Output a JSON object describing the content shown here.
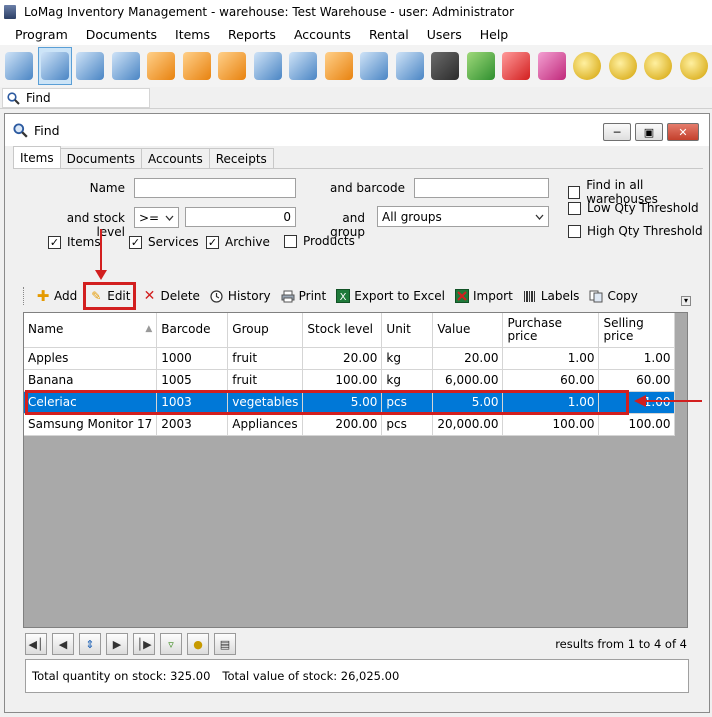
{
  "app": {
    "title": "LoMag Inventory Management - warehouse: Test Warehouse - user: Administrator"
  },
  "menu": [
    "Program",
    "Documents",
    "Items",
    "Reports",
    "Accounts",
    "Rental",
    "Users",
    "Help"
  ],
  "find_tab": {
    "label": "Find"
  },
  "window": {
    "title": "Find"
  },
  "subtabs": [
    "Items",
    "Documents",
    "Accounts",
    "Receipts"
  ],
  "form": {
    "name_label": "Name",
    "name_value": "",
    "barcode_label": "and barcode",
    "barcode_value": "",
    "stock_level_label": "and stock level",
    "stock_operator": ">=",
    "stock_value": "0",
    "group_label": "and group",
    "group_value": "All groups",
    "checks": {
      "items": {
        "label": "Items",
        "checked": true
      },
      "services": {
        "label": "Services",
        "checked": true
      },
      "archive": {
        "label": "Archive",
        "checked": true
      },
      "products": {
        "label": "Products",
        "checked": false
      },
      "all_warehouses": {
        "label": "Find in all warehouses",
        "checked": false
      },
      "low_qty": {
        "label": "Low Qty Threshold",
        "checked": false
      },
      "high_qty": {
        "label": "High Qty Threshold",
        "checked": false
      }
    }
  },
  "actions": {
    "add": "Add",
    "edit": "Edit",
    "delete": "Delete",
    "history": "History",
    "print": "Print",
    "export": "Export to Excel",
    "import": "Import",
    "labels": "Labels",
    "copy": "Copy"
  },
  "table": {
    "columns": [
      "Name",
      "Barcode",
      "Group",
      "Stock level",
      "Unit",
      "Value",
      "Purchase price",
      "Selling price"
    ],
    "rows": [
      [
        "Apples",
        "1000",
        "fruit",
        "20.00",
        "kg",
        "20.00",
        "1.00",
        "1.00"
      ],
      [
        "Banana",
        "1005",
        "fruit",
        "100.00",
        "kg",
        "6,000.00",
        "60.00",
        "60.00"
      ],
      [
        "Celeriac",
        "1003",
        "vegetables",
        "5.00",
        "pcs",
        "5.00",
        "1.00",
        "1.00"
      ],
      [
        "Samsung Monitor 17",
        "2003",
        "Appliances",
        "200.00",
        "pcs",
        "20,000.00",
        "100.00",
        "100.00"
      ]
    ],
    "selected_row": 2
  },
  "results_text": "results from 1 to 4 of 4",
  "totals": {
    "quantity": "Total quantity on stock: 325.00",
    "value": "Total value of stock: 26,025.00"
  },
  "colors": {
    "selection": "#0078d7",
    "annotation": "#d21f1f"
  }
}
